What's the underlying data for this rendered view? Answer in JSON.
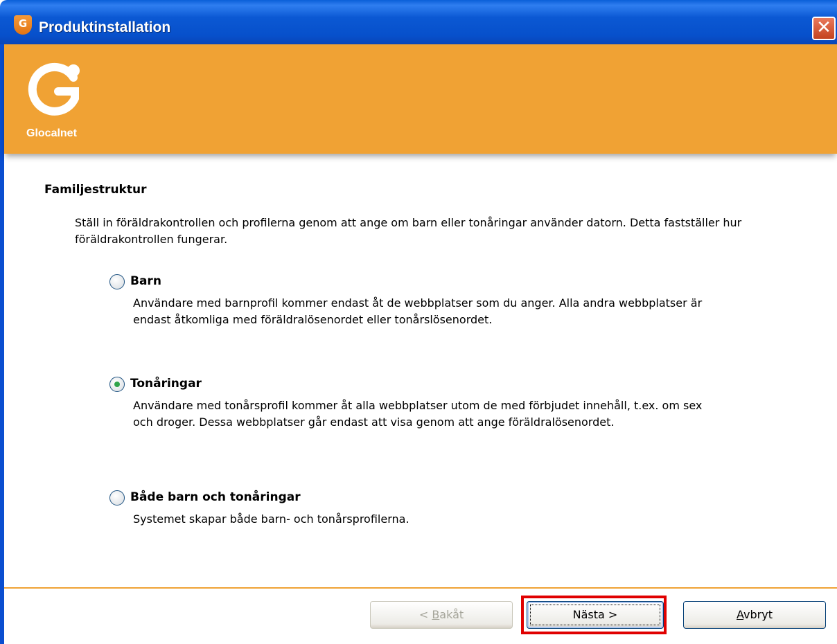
{
  "window": {
    "title": "Produktinstallation",
    "icon": "shield-g-icon",
    "close_glyph": "✕"
  },
  "banner": {
    "logo_letter": "G",
    "logo_text": "Glocalnet",
    "color": "#f0a234"
  },
  "content": {
    "heading": "Familjestruktur",
    "intro": "Ställ in föräldrakontrollen och profilerna genom att ange om barn eller tonåringar använder datorn. Detta fastställer hur föräldrakontrollen fungerar.",
    "options": [
      {
        "label": "Barn",
        "selected": false,
        "description": "Användare med barnprofil kommer endast åt de webbplatser som du anger. Alla andra webbplatser är endast åtkomliga med föräldralösenordet eller tonårslösenordet."
      },
      {
        "label": "Tonåringar",
        "selected": true,
        "description": "Användare med tonårsprofil kommer åt alla webbplatser utom de med förbjudet innehåll, t.ex. om sex och droger. Dessa webbplatser går endast att visa genom att ange föräldralösenordet."
      },
      {
        "label": "Både barn och tonåringar",
        "selected": false,
        "description": "Systemet skapar både barn- och tonårsprofilerna."
      }
    ]
  },
  "buttons": {
    "back_prefix": "< ",
    "back_accel": "B",
    "back_rest": "akåt",
    "next_label": "Nästa >",
    "cancel_accel": "A",
    "cancel_rest": "vbryt"
  },
  "highlight_color": "#e00000"
}
